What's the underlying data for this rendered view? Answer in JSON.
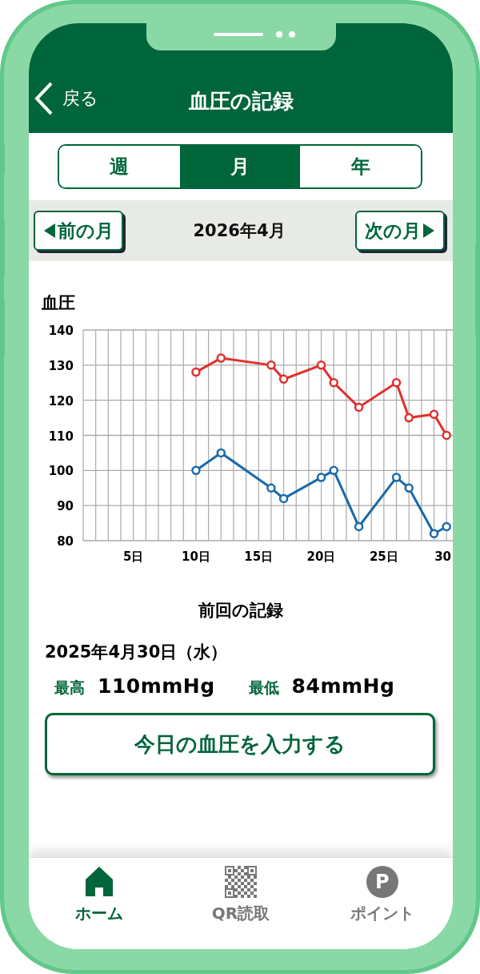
{
  "header": {
    "back_label": "戻る",
    "title": "血圧の記録"
  },
  "period_tabs": [
    {
      "label": "週",
      "selected": false
    },
    {
      "label": "月",
      "selected": true
    },
    {
      "label": "年",
      "selected": false
    }
  ],
  "month_nav": {
    "prev_label": "前の月",
    "current": "2026年4月",
    "next_label": "次の月"
  },
  "chart": {
    "title": "血圧",
    "chart_data": {
      "type": "line",
      "xlim": [
        1,
        30.5
      ],
      "ylim": [
        80,
        140
      ],
      "xticks": [
        {
          "value": 5,
          "label": "5日"
        },
        {
          "value": 10,
          "label": "10日"
        },
        {
          "value": 15,
          "label": "15日"
        },
        {
          "value": 20,
          "label": "20日"
        },
        {
          "value": 25,
          "label": "25日"
        },
        {
          "value": 30,
          "label": "30"
        }
      ],
      "yticks": [
        80,
        90,
        100,
        110,
        120,
        130,
        140
      ],
      "x": [
        10,
        12,
        16,
        17,
        20,
        21,
        23,
        26,
        27,
        29,
        30
      ],
      "grid": true,
      "series": [
        {
          "color": "#e0302c",
          "marker": "circle",
          "values": [
            128,
            132,
            130,
            126,
            130,
            125,
            118,
            125,
            115,
            116,
            110
          ]
        },
        {
          "color": "#1a6aaa",
          "marker": "circle",
          "values": [
            100,
            105,
            95,
            92,
            98,
            100,
            84,
            98,
            95,
            82,
            84
          ]
        }
      ]
    }
  },
  "last_record": {
    "heading": "前回の記録",
    "date": "2025年4月30日（水）",
    "high_label": "最高",
    "high_value": "110mmHg",
    "low_label": "最低",
    "low_value": "84mmHg"
  },
  "input_button": "今日の血圧を入力する",
  "bottom_nav": [
    {
      "kind": "home",
      "label": "ホーム",
      "selected": true
    },
    {
      "kind": "qr",
      "label": "QR読取",
      "selected": false
    },
    {
      "kind": "point",
      "label": "ポイント",
      "badge": "P",
      "selected": false
    }
  ]
}
